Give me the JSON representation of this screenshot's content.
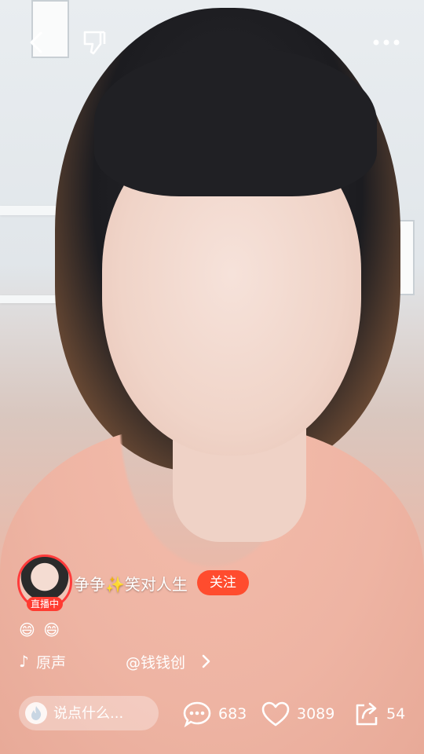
{
  "topbar": {
    "back_icon": "back-arrow-icon",
    "dislike_icon": "thumbs-down-icon",
    "more_icon": "more-dots-icon"
  },
  "anchor": {
    "live_badge": "直播中",
    "name": "争争✨笑对人生",
    "follow_label": "关注"
  },
  "caption": {
    "emojis": "😄 😄"
  },
  "music": {
    "icon": "music-note-icon",
    "name": "原声",
    "author": "@钱钱创",
    "chevron_icon": "chevron-right-icon"
  },
  "bottom": {
    "comment_placeholder": "说点什么...",
    "comments_count": "683",
    "likes_count": "3089",
    "shares_count": "54"
  },
  "colors": {
    "live_red": "#ff3b30",
    "follow_orange": "#ff4c2e"
  }
}
